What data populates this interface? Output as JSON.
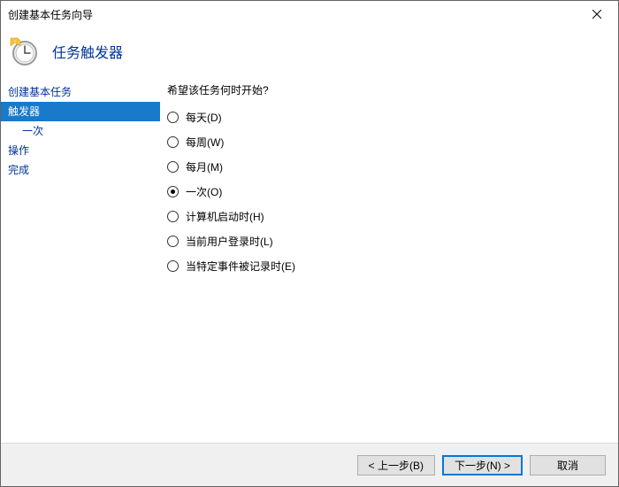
{
  "window": {
    "title": "创建基本任务向导"
  },
  "header": {
    "title": "任务触发器"
  },
  "sidebar": {
    "items": [
      {
        "label": "创建基本任务",
        "selected": false,
        "indent": false
      },
      {
        "label": "触发器",
        "selected": true,
        "indent": false
      },
      {
        "label": "一次",
        "selected": false,
        "indent": true
      },
      {
        "label": "操作",
        "selected": false,
        "indent": false
      },
      {
        "label": "完成",
        "selected": false,
        "indent": false
      }
    ]
  },
  "main": {
    "prompt": "希望该任务何时开始?",
    "options": [
      {
        "label": "每天(D)",
        "checked": false
      },
      {
        "label": "每周(W)",
        "checked": false
      },
      {
        "label": "每月(M)",
        "checked": false
      },
      {
        "label": "一次(O)",
        "checked": true
      },
      {
        "label": "计算机启动时(H)",
        "checked": false
      },
      {
        "label": "当前用户登录时(L)",
        "checked": false
      },
      {
        "label": "当特定事件被记录时(E)",
        "checked": false
      }
    ]
  },
  "footer": {
    "back": "< 上一步(B)",
    "next": "下一步(N) >",
    "cancel": "取消"
  }
}
